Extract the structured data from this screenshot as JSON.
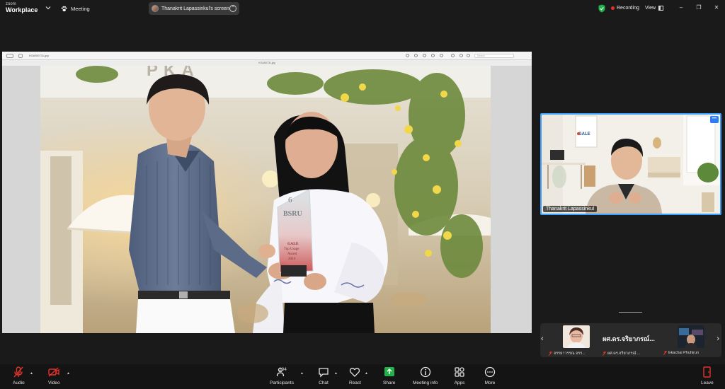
{
  "topbar": {
    "brand_line1": "zoom",
    "brand_line2": "Workplace",
    "meeting_label": "Meeting",
    "share_pill_label": "Thanakrit Lapassinkul's screen",
    "recording_label": "Recording",
    "view_label": "View"
  },
  "shared_screen": {
    "viewer_filename": "KGASI0731.jpg",
    "viewer_title": "KGAS0731.jpg",
    "search_placeholder": "Search",
    "trophy_lines": [
      "6",
      "BSRU",
      "GALE",
      "Top Usage",
      "Award",
      "2024"
    ]
  },
  "speaker": {
    "name": "Thanakrit Lapassinkul",
    "logo_text": "GALE",
    "more_label": "•••"
  },
  "strip": {
    "left_arrow": "‹",
    "right_arrow": "›",
    "tiles": [
      {
        "name": "จรรยาวรรณ  จรร..."
      },
      {
        "big": "ผศ.ดร.จริยาภรณ์...",
        "name": "ผศ.ดร.จริยาภรณ์ ..."
      },
      {
        "name": "Ekachai Phuhirun"
      }
    ]
  },
  "toolbar": {
    "audio": "Audio",
    "video": "Video",
    "participants": "Participants",
    "participants_count": "104",
    "chat": "Chat",
    "react": "React",
    "share": "Share",
    "meeting_info": "Meeting info",
    "apps": "Apps",
    "more": "More",
    "leave": "Leave"
  },
  "colors": {
    "accent_blue": "#3aa0ff",
    "share_green": "#22b24c",
    "mute_red": "#e5332a",
    "recording_red": "#e5332a"
  }
}
